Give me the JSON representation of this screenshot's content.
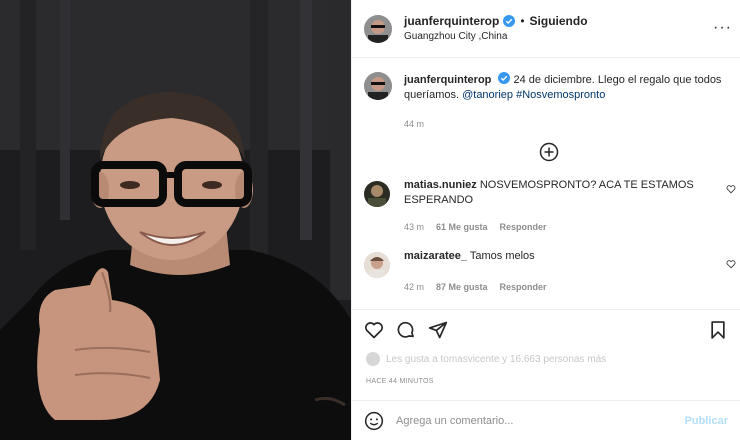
{
  "post": {
    "username": "juanferquinterop",
    "follow_status": "Siguiendo",
    "dot": "•",
    "location": "Guangzhou City ,China",
    "more": "···"
  },
  "caption": {
    "username": "juanferquinterop",
    "text": "24 de diciembre. Llego el regalo que todos queríamos.",
    "mention": "@tanoriep",
    "hashtag": "#Nosvemospronto",
    "time": "44 m"
  },
  "comments": [
    {
      "username": "matias.nuniez",
      "text": "NOSVEMOSPRONTO? ACA TE ESTAMOS ESPERANDO",
      "time": "43 m",
      "likes": "61 Me gusta",
      "reply": "Responder"
    },
    {
      "username": "maizaratee_",
      "text": "Tamos melos",
      "time": "42 m",
      "likes": "87 Me gusta",
      "reply": "Responder"
    }
  ],
  "likes_text": "Les gusta a tomasvicente y 16.663 personas más",
  "time_ago": "HACE 44 MINUTOS",
  "add_comment": {
    "placeholder": "Agrega un comentario...",
    "publish": "Publicar"
  },
  "colors": {
    "link": "#00376b",
    "verified": "#3897f0",
    "muted": "#8e8e8e",
    "publish": "#b2dffc"
  },
  "icons": [
    "verified-badge-icon",
    "more-options-icon",
    "add-comment-icon",
    "heart-icon",
    "comment-icon",
    "share-icon",
    "bookmark-icon",
    "emoji-icon"
  ]
}
